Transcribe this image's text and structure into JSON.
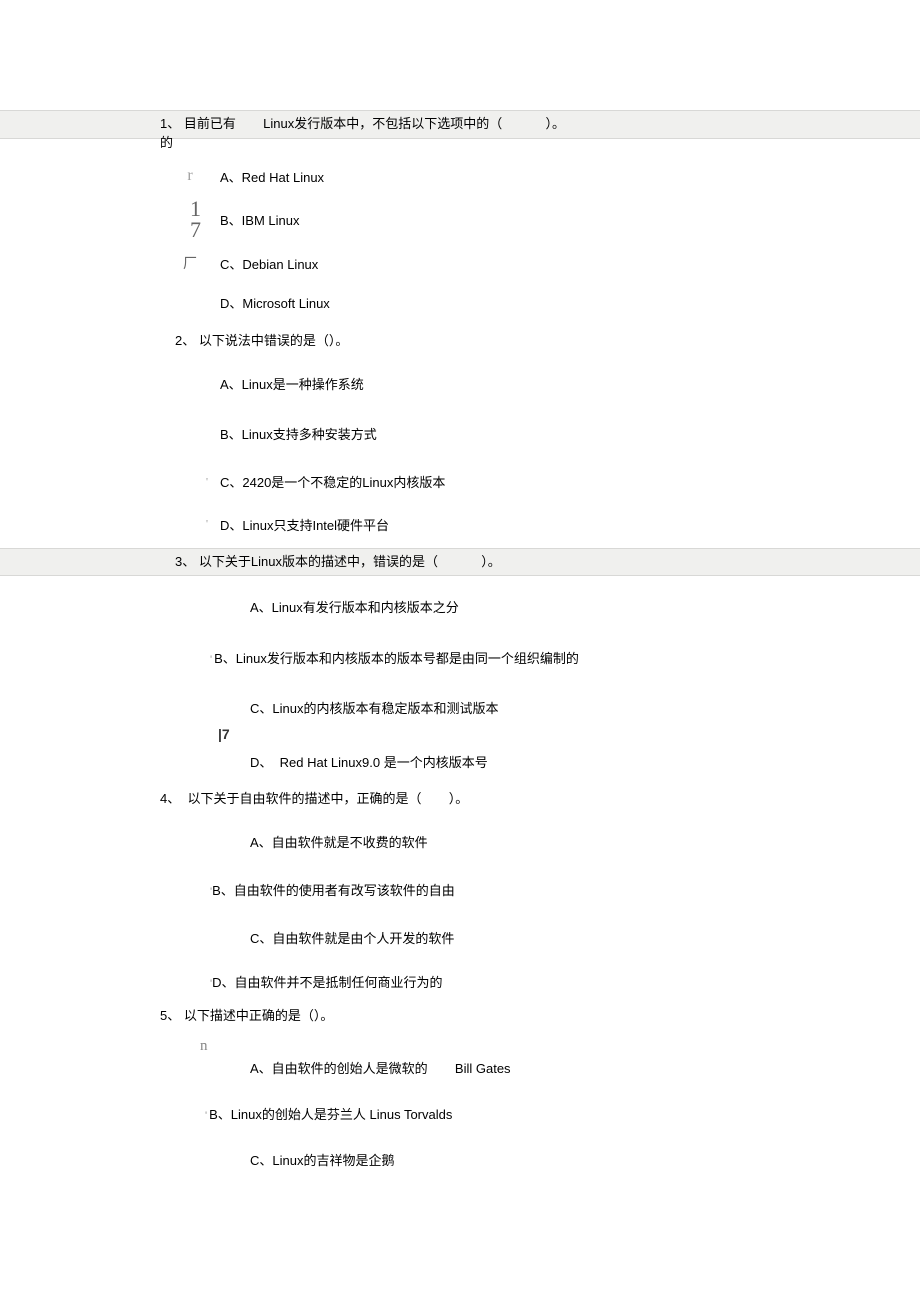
{
  "questions": [
    {
      "number": "1、",
      "prefix": "目前已有",
      "mid": "Linux发行版本中，不包括以下选项中的（",
      "suffix": "）。",
      "sub": "的",
      "options": [
        {
          "marker": "r",
          "text": "A、Red Hat Linux"
        },
        {
          "stack": [
            "1",
            "7"
          ],
          "text": "B、IBM Linux"
        },
        {
          "marker": "厂",
          "text": "C、Debian Linux"
        },
        {
          "marker": "",
          "text": "D、Microsoft Linux"
        }
      ]
    },
    {
      "number": "2、",
      "text": "以下说法中错误的是（）。",
      "options": [
        {
          "marker": "",
          "text": "A、Linux是一种操作系统"
        },
        {
          "marker": "",
          "text": "B、Linux支持多种安装方式"
        },
        {
          "tick": "'",
          "text": "C、2420是一个不稳定的Linux内核版本"
        },
        {
          "tick": "'",
          "text": "D、Linux只支持Intel硬件平台"
        }
      ]
    },
    {
      "number": "3、",
      "prefix": "以下关于Linux版本的描述中，错误的是（",
      "suffix": "）。",
      "options": [
        {
          "marker": "",
          "text": "A、Linux有发行版本和内核版本之分"
        },
        {
          "tickb": "'",
          "text": "B、Linux发行版本和内核版本的版本号都是由同一个组织编制的"
        },
        {
          "marker": "",
          "text": "C、Linux的内核版本有稳定版本和测试版本"
        },
        {
          "imark": "|7",
          "pre": "D、",
          "text": "Red Hat Linux9.0  是一个内核版本号"
        }
      ]
    },
    {
      "number": "4、",
      "prefix": "以下关于自由软件的描述中，正确的是（",
      "suffix": "）。",
      "options": [
        {
          "marker": "",
          "text": "A、自由软件就是不收费的软件"
        },
        {
          "tickb": "'",
          "text": "B、自由软件的使用者有改写该软件的自由"
        },
        {
          "marker": "",
          "text": "C、自由软件就是由个人开发的软件"
        },
        {
          "tickb": "'",
          "text": "D、自由软件并不是抵制任何商业行为的"
        }
      ]
    },
    {
      "number": "5、",
      "text": "以下描述中正确的是（）。",
      "options": [
        {
          "nmark": "n",
          "pre": "A、自由软件的创始人是微软的",
          "text": "Bill Gates"
        },
        {
          "tick2": "'",
          "pre": "B、Linux的创始人是芬兰人 ",
          "text": "Linus Torvalds"
        },
        {
          "marker": "",
          "text": "C、Linux的吉祥物是企鹅"
        }
      ]
    }
  ]
}
